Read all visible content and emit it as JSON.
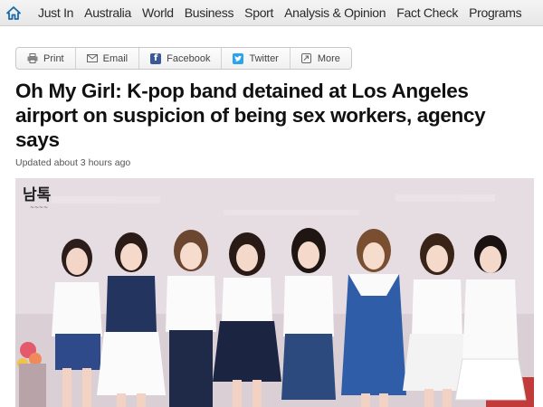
{
  "nav": {
    "home_icon": "home-icon",
    "items": [
      "Just In",
      "Australia",
      "World",
      "Business",
      "Sport",
      "Analysis & Opinion",
      "Fact Check",
      "Programs"
    ],
    "accent": "#1a6aa8"
  },
  "share": {
    "print": "Print",
    "email": "Email",
    "facebook": "Facebook",
    "twitter": "Twitter",
    "more": "More"
  },
  "article": {
    "headline": "Oh My Girl: K-pop band detained at Los Angeles airport on suspicion of being sex workers, agency says",
    "updated": "Updated about 3 hours ago"
  },
  "photo": {
    "watermark": "남톡",
    "description_people": 8
  }
}
